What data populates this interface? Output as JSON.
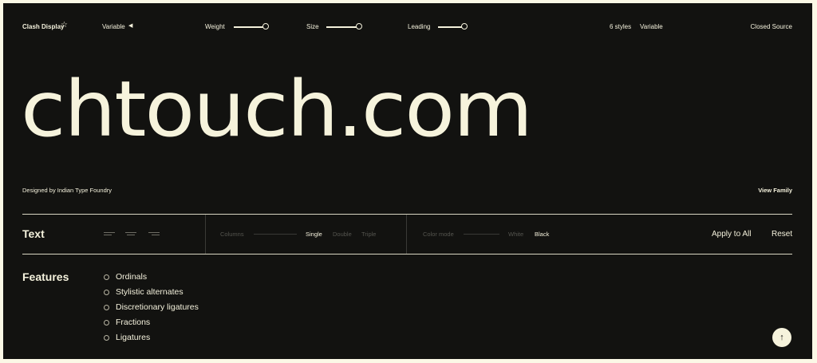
{
  "header": {
    "font_name": "Clash Display",
    "star_icon": "star-outline-icon",
    "variable_label": "Variable",
    "weight_label": "Weight",
    "size_label": "Size",
    "leading_label": "Leading",
    "styles_count": "6 styles",
    "variable_tag": "Variable",
    "license": "Closed Source",
    "weight_level": 0.95,
    "size_level": 0.95,
    "leading_level": 0.95
  },
  "preview_text": "chtouch.com",
  "meta": {
    "designer": "Designed by Indian Type Foundry",
    "view_family": "View Family"
  },
  "text_controls": {
    "title": "Text",
    "alignments": [
      "align-left-icon",
      "align-center-icon",
      "align-right-icon"
    ],
    "columns_label": "Columns",
    "column_options": [
      "Single",
      "Double",
      "Triple"
    ],
    "column_selected": "Single",
    "color_mode_label": "Color mode",
    "color_options": [
      "White",
      "Black"
    ],
    "color_selected": "Black",
    "apply_all": "Apply to All",
    "reset": "Reset"
  },
  "features": {
    "title": "Features",
    "items": [
      "Ordinals",
      "Stylistic alternates",
      "Discretionary ligatures",
      "Fractions",
      "Ligatures"
    ]
  },
  "scroll_top_icon": "arrow-up-icon",
  "colors": {
    "background": "#121210",
    "foreground": "#f4f1dc",
    "page": "#fbf8e6"
  }
}
